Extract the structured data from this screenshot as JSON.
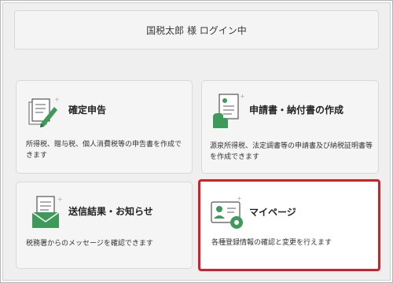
{
  "login_status": "国税太郎 様 ログイン中",
  "cards": [
    {
      "title": "確定申告",
      "description": "所得税、贈与税、個人消費税等の申告書を作成できます",
      "icon": "document-pen-icon"
    },
    {
      "title": "申請書・納付書の作成",
      "description": "源泉所得税、法定調書等の申請書及び納税証明書等を作成できます",
      "icon": "hand-document-icon"
    },
    {
      "title": "送信結果・お知らせ",
      "description": "税務署からのメッセージを確認できます",
      "icon": "envelope-message-icon"
    },
    {
      "title": "マイページ",
      "description": "各種登録情報の確認と変更を行えます",
      "icon": "profile-settings-icon"
    }
  ],
  "colors": {
    "highlight_border": "#d61e2a",
    "icon_green": "#3e9a59",
    "page_background": "#efefef"
  }
}
